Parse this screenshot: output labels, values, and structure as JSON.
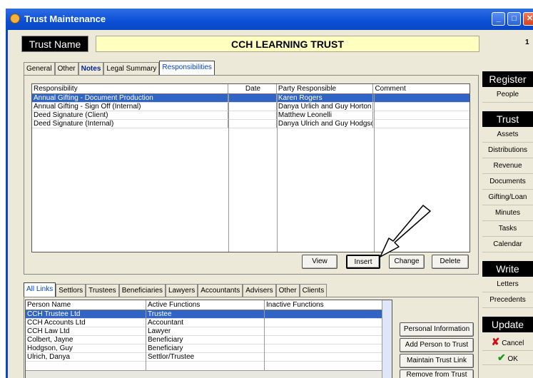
{
  "window": {
    "title": "Trust Maintenance",
    "min": "_",
    "max": "□",
    "close": "✕"
  },
  "trust": {
    "label": "Trust Name",
    "value": "CCH LEARNING TRUST",
    "count": "1"
  },
  "top_tabs": [
    "General",
    "Other",
    "Notes",
    "Legal Summary",
    "Responsibilities"
  ],
  "responsibilities": {
    "headers": [
      "Responsibility",
      "Date",
      "Party Responsible",
      "Comment"
    ],
    "rows": [
      {
        "responsibility": "Annual Gifting - Document Production",
        "date": "",
        "party": "Karen Rogers",
        "comment": ""
      },
      {
        "responsibility": "Annual Gifting - Sign Off (Internal)",
        "date": "",
        "party": "Danya Urlich and Guy Horton",
        "comment": ""
      },
      {
        "responsibility": "Deed Signature (Client)",
        "date": "",
        "party": "Matthew Leonelli",
        "comment": ""
      },
      {
        "responsibility": "Deed Signature (Internal)",
        "date": "",
        "party": "Danya Ulrich and Guy Hodgso",
        "comment": ""
      }
    ],
    "buttons": {
      "view": "View",
      "insert": "Insert",
      "change": "Change",
      "delete": "Delete"
    }
  },
  "link_tabs": [
    "All Links",
    "Settlors",
    "Trustees",
    "Beneficiaries",
    "Lawyers",
    "Accountants",
    "Advisers",
    "Other",
    "Clients"
  ],
  "links": {
    "headers": [
      "Person Name",
      "Active Functions",
      "Inactive Functions"
    ],
    "rows": [
      {
        "name": "CCH Trustee Ltd",
        "active": "Trustee",
        "inactive": ""
      },
      {
        "name": "CCH Accounts Ltd",
        "active": "Accountant",
        "inactive": ""
      },
      {
        "name": "CCH Law Ltd",
        "active": "Lawyer",
        "inactive": ""
      },
      {
        "name": "Colbert, Jayne",
        "active": "Beneficiary",
        "inactive": ""
      },
      {
        "name": "Hodgson, Guy",
        "active": "Beneficiary",
        "inactive": ""
      },
      {
        "name": "Ulrich, Danya",
        "active": "Settlor/Trustee",
        "inactive": ""
      }
    ],
    "buttons": [
      "Personal Information",
      "Add Person to Trust",
      "Maintain Trust Link",
      "Remove from Trust"
    ]
  },
  "sidebar": {
    "register": {
      "title": "Register",
      "items": [
        "People"
      ]
    },
    "trust": {
      "title": "Trust",
      "items": [
        "Assets",
        "Distributions",
        "Revenue",
        "Documents",
        "Gifting/Loan",
        "Minutes",
        "Tasks",
        "Calendar"
      ]
    },
    "write": {
      "title": "Write",
      "items": [
        "Letters",
        "Precedents"
      ]
    },
    "update": {
      "title": "Update",
      "cancel": "Cancel",
      "ok": "OK"
    }
  }
}
